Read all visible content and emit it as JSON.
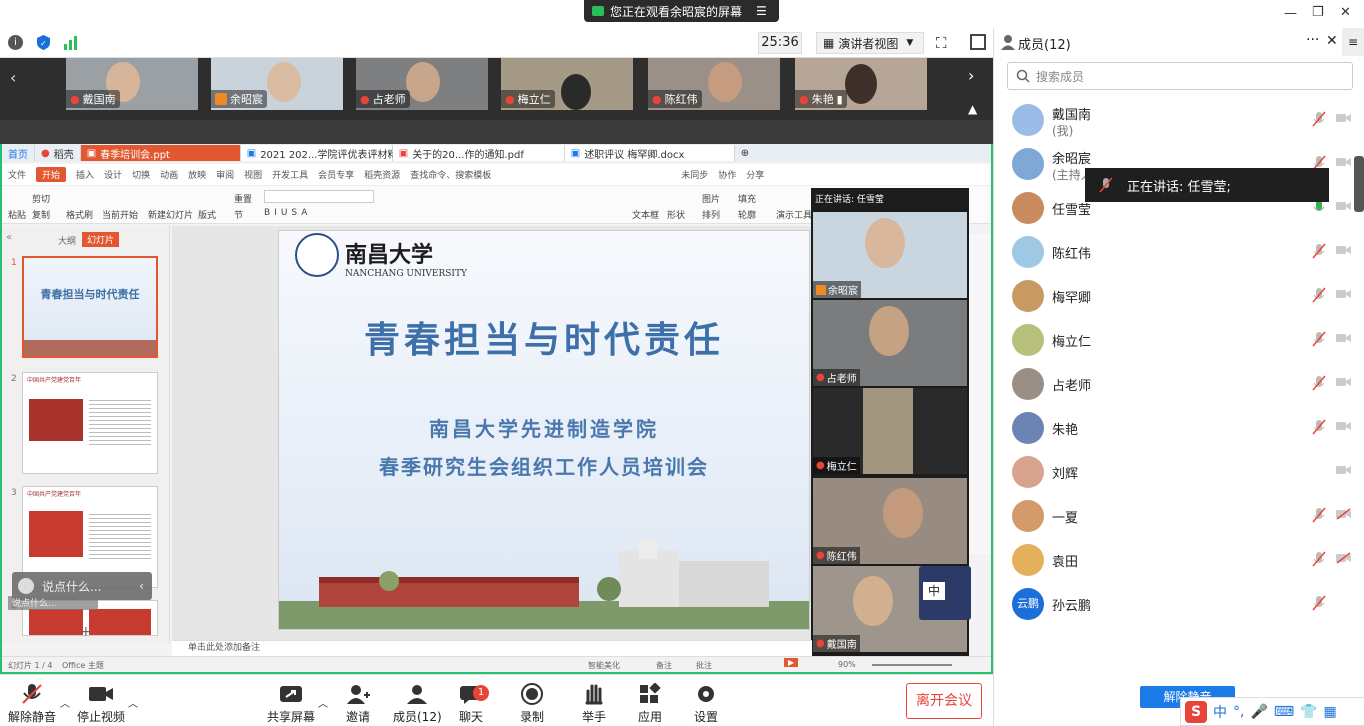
{
  "share_banner": {
    "text": "您正在观看余昭宸的屏幕"
  },
  "window_controls": {
    "minimize": "—",
    "restore": "❐",
    "close": "✕"
  },
  "topbar": {
    "time": "25:36",
    "view_label": "演讲者视图"
  },
  "strip": {
    "participants": [
      {
        "name": "戴国南",
        "muted": true
      },
      {
        "name": "余昭宸",
        "muted": false,
        "host": true
      },
      {
        "name": "占老师",
        "muted": true
      },
      {
        "name": "梅立仁",
        "muted": true
      },
      {
        "name": "陈红伟",
        "muted": true
      },
      {
        "name": "朱艳",
        "muted": true
      }
    ]
  },
  "wps": {
    "tabs": [
      {
        "label": "首页"
      },
      {
        "label": "稻壳"
      },
      {
        "label": "春季培训会.ppt"
      },
      {
        "label": "2021 202...学院评优表评材料"
      },
      {
        "label": "关于的20...作的通知.pdf"
      },
      {
        "label": "述职评议 梅罕卿.docx"
      }
    ],
    "menu": [
      "文件",
      "开始",
      "插入",
      "设计",
      "切换",
      "动画",
      "放映",
      "审阅",
      "视图",
      "开发工具",
      "会员专享",
      "稻壳资源",
      "查找命令、搜索模板",
      "未同步",
      "协作",
      "分享"
    ],
    "ribbon": [
      "粘贴",
      "剪切",
      "复制",
      "格式刷",
      "当前开始",
      "新建幻灯片",
      "版式",
      "重置",
      "节",
      "文本框",
      "形状",
      "排列",
      "演示工具",
      "图片",
      "填充",
      "轮廓"
    ],
    "pane_tabs": [
      "大纲",
      "幻灯片"
    ],
    "slide_numbers": [
      "1",
      "2",
      "3",
      "4"
    ],
    "thumb_titles": [
      "青春担当与时代责任",
      "中国共产党建党百年",
      "中国共产党建党百年"
    ],
    "notes_placeholder": "单击此处添加备注",
    "status_left": "幻灯片 1 / 4",
    "status_office": "Office 主题",
    "status_right": [
      "智能美化",
      "备注",
      "批注",
      "90%"
    ],
    "chat_hint": "说点什么...",
    "chat_hint_small": "说点什么..."
  },
  "slide": {
    "univ_cn": "南昌大学",
    "univ_en": "NANCHANG UNIVERSITY",
    "title": "青春担当与时代责任",
    "sub1": "南昌大学先进制造学院",
    "sub2": "春季研究生会组织工作人员培训会"
  },
  "video_col": {
    "speaking": "正在讲话: 任雪莹",
    "tiles": [
      "余昭宸",
      "占老师",
      "梅立仁",
      "陈红伟",
      "戴国南"
    ],
    "ime_badge": "中"
  },
  "bottom": {
    "mute": "解除静音",
    "video": "停止视频",
    "share": "共享屏幕",
    "invite": "邀请",
    "members": "成员(12)",
    "chat": "聊天",
    "chat_badge": "1",
    "record": "录制",
    "raise": "举手",
    "apps": "应用",
    "settings": "设置",
    "leave": "离开会议"
  },
  "panel": {
    "title": "成员(12)",
    "search_placeholder": "搜索成员",
    "tooltip": "正在讲话: 任雪莹;",
    "unmute_all": "解除静音",
    "members": [
      {
        "name": "戴国南",
        "sub": "(我)",
        "mic": "muted",
        "cam": "off"
      },
      {
        "name": "余昭宸",
        "sub": "(主持人)",
        "mic": "muted",
        "cam": "off"
      },
      {
        "name": "任雪莹",
        "sub": "",
        "mic": "on",
        "cam": "off"
      },
      {
        "name": "陈红伟",
        "sub": "",
        "mic": "muted",
        "cam": "off"
      },
      {
        "name": "梅罕卿",
        "sub": "",
        "mic": "muted",
        "cam": "off"
      },
      {
        "name": "梅立仁",
        "sub": "",
        "mic": "muted",
        "cam": "off"
      },
      {
        "name": "占老师",
        "sub": "",
        "mic": "muted",
        "cam": "off"
      },
      {
        "name": "朱艳",
        "sub": "",
        "mic": "muted",
        "cam": "off"
      },
      {
        "name": "刘辉",
        "sub": "",
        "mic": "none",
        "cam": "off"
      },
      {
        "name": "一夏",
        "sub": "",
        "mic": "muted",
        "cam": "offred"
      },
      {
        "name": "袁田",
        "sub": "",
        "mic": "muted",
        "cam": "offred"
      },
      {
        "name": "孙云鹏",
        "sub": "",
        "mic": "muted",
        "cam": "none",
        "avatar_text": "云鹏"
      }
    ]
  },
  "ime": {
    "label": "中"
  },
  "colors": {
    "accent": "#1b7ce8",
    "share_border": "#25c16f",
    "muted_red": "#e8443a",
    "mic_green": "#32b54b",
    "slide_title": "#3d6fa8"
  }
}
